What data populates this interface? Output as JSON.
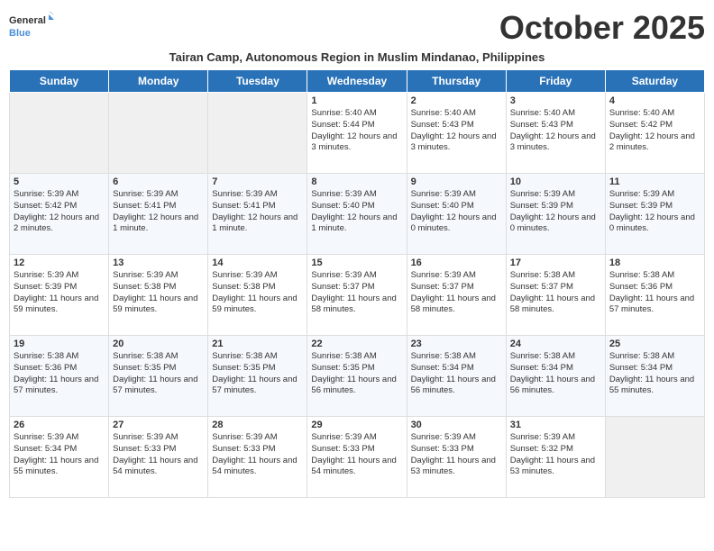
{
  "logo": {
    "line1": "General",
    "line2": "Blue"
  },
  "title": "October 2025",
  "subtitle": "Tairan Camp, Autonomous Region in Muslim Mindanao, Philippines",
  "weekdays": [
    "Sunday",
    "Monday",
    "Tuesday",
    "Wednesday",
    "Thursday",
    "Friday",
    "Saturday"
  ],
  "weeks": [
    [
      {
        "day": "",
        "empty": true
      },
      {
        "day": "",
        "empty": true
      },
      {
        "day": "",
        "empty": true
      },
      {
        "day": "1",
        "sunrise": "Sunrise: 5:40 AM",
        "sunset": "Sunset: 5:44 PM",
        "daylight": "Daylight: 12 hours and 3 minutes."
      },
      {
        "day": "2",
        "sunrise": "Sunrise: 5:40 AM",
        "sunset": "Sunset: 5:43 PM",
        "daylight": "Daylight: 12 hours and 3 minutes."
      },
      {
        "day": "3",
        "sunrise": "Sunrise: 5:40 AM",
        "sunset": "Sunset: 5:43 PM",
        "daylight": "Daylight: 12 hours and 3 minutes."
      },
      {
        "day": "4",
        "sunrise": "Sunrise: 5:40 AM",
        "sunset": "Sunset: 5:42 PM",
        "daylight": "Daylight: 12 hours and 2 minutes."
      }
    ],
    [
      {
        "day": "5",
        "sunrise": "Sunrise: 5:39 AM",
        "sunset": "Sunset: 5:42 PM",
        "daylight": "Daylight: 12 hours and 2 minutes."
      },
      {
        "day": "6",
        "sunrise": "Sunrise: 5:39 AM",
        "sunset": "Sunset: 5:41 PM",
        "daylight": "Daylight: 12 hours and 1 minute."
      },
      {
        "day": "7",
        "sunrise": "Sunrise: 5:39 AM",
        "sunset": "Sunset: 5:41 PM",
        "daylight": "Daylight: 12 hours and 1 minute."
      },
      {
        "day": "8",
        "sunrise": "Sunrise: 5:39 AM",
        "sunset": "Sunset: 5:40 PM",
        "daylight": "Daylight: 12 hours and 1 minute."
      },
      {
        "day": "9",
        "sunrise": "Sunrise: 5:39 AM",
        "sunset": "Sunset: 5:40 PM",
        "daylight": "Daylight: 12 hours and 0 minutes."
      },
      {
        "day": "10",
        "sunrise": "Sunrise: 5:39 AM",
        "sunset": "Sunset: 5:39 PM",
        "daylight": "Daylight: 12 hours and 0 minutes."
      },
      {
        "day": "11",
        "sunrise": "Sunrise: 5:39 AM",
        "sunset": "Sunset: 5:39 PM",
        "daylight": "Daylight: 12 hours and 0 minutes."
      }
    ],
    [
      {
        "day": "12",
        "sunrise": "Sunrise: 5:39 AM",
        "sunset": "Sunset: 5:39 PM",
        "daylight": "Daylight: 11 hours and 59 minutes."
      },
      {
        "day": "13",
        "sunrise": "Sunrise: 5:39 AM",
        "sunset": "Sunset: 5:38 PM",
        "daylight": "Daylight: 11 hours and 59 minutes."
      },
      {
        "day": "14",
        "sunrise": "Sunrise: 5:39 AM",
        "sunset": "Sunset: 5:38 PM",
        "daylight": "Daylight: 11 hours and 59 minutes."
      },
      {
        "day": "15",
        "sunrise": "Sunrise: 5:39 AM",
        "sunset": "Sunset: 5:37 PM",
        "daylight": "Daylight: 11 hours and 58 minutes."
      },
      {
        "day": "16",
        "sunrise": "Sunrise: 5:39 AM",
        "sunset": "Sunset: 5:37 PM",
        "daylight": "Daylight: 11 hours and 58 minutes."
      },
      {
        "day": "17",
        "sunrise": "Sunrise: 5:38 AM",
        "sunset": "Sunset: 5:37 PM",
        "daylight": "Daylight: 11 hours and 58 minutes."
      },
      {
        "day": "18",
        "sunrise": "Sunrise: 5:38 AM",
        "sunset": "Sunset: 5:36 PM",
        "daylight": "Daylight: 11 hours and 57 minutes."
      }
    ],
    [
      {
        "day": "19",
        "sunrise": "Sunrise: 5:38 AM",
        "sunset": "Sunset: 5:36 PM",
        "daylight": "Daylight: 11 hours and 57 minutes."
      },
      {
        "day": "20",
        "sunrise": "Sunrise: 5:38 AM",
        "sunset": "Sunset: 5:35 PM",
        "daylight": "Daylight: 11 hours and 57 minutes."
      },
      {
        "day": "21",
        "sunrise": "Sunrise: 5:38 AM",
        "sunset": "Sunset: 5:35 PM",
        "daylight": "Daylight: 11 hours and 57 minutes."
      },
      {
        "day": "22",
        "sunrise": "Sunrise: 5:38 AM",
        "sunset": "Sunset: 5:35 PM",
        "daylight": "Daylight: 11 hours and 56 minutes."
      },
      {
        "day": "23",
        "sunrise": "Sunrise: 5:38 AM",
        "sunset": "Sunset: 5:34 PM",
        "daylight": "Daylight: 11 hours and 56 minutes."
      },
      {
        "day": "24",
        "sunrise": "Sunrise: 5:38 AM",
        "sunset": "Sunset: 5:34 PM",
        "daylight": "Daylight: 11 hours and 56 minutes."
      },
      {
        "day": "25",
        "sunrise": "Sunrise: 5:38 AM",
        "sunset": "Sunset: 5:34 PM",
        "daylight": "Daylight: 11 hours and 55 minutes."
      }
    ],
    [
      {
        "day": "26",
        "sunrise": "Sunrise: 5:39 AM",
        "sunset": "Sunset: 5:34 PM",
        "daylight": "Daylight: 11 hours and 55 minutes."
      },
      {
        "day": "27",
        "sunrise": "Sunrise: 5:39 AM",
        "sunset": "Sunset: 5:33 PM",
        "daylight": "Daylight: 11 hours and 54 minutes."
      },
      {
        "day": "28",
        "sunrise": "Sunrise: 5:39 AM",
        "sunset": "Sunset: 5:33 PM",
        "daylight": "Daylight: 11 hours and 54 minutes."
      },
      {
        "day": "29",
        "sunrise": "Sunrise: 5:39 AM",
        "sunset": "Sunset: 5:33 PM",
        "daylight": "Daylight: 11 hours and 54 minutes."
      },
      {
        "day": "30",
        "sunrise": "Sunrise: 5:39 AM",
        "sunset": "Sunset: 5:33 PM",
        "daylight": "Daylight: 11 hours and 53 minutes."
      },
      {
        "day": "31",
        "sunrise": "Sunrise: 5:39 AM",
        "sunset": "Sunset: 5:32 PM",
        "daylight": "Daylight: 11 hours and 53 minutes."
      },
      {
        "day": "",
        "empty": true
      }
    ]
  ]
}
